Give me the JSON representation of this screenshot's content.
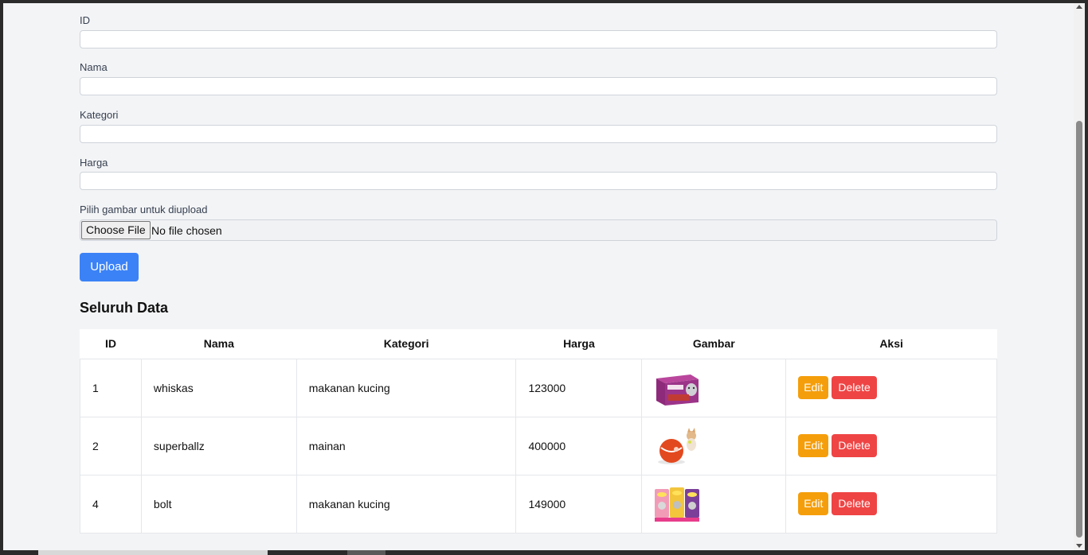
{
  "form": {
    "fields": [
      {
        "label": "ID",
        "value": ""
      },
      {
        "label": "Nama",
        "value": ""
      },
      {
        "label": "Kategori",
        "value": ""
      },
      {
        "label": "Harga",
        "value": ""
      }
    ],
    "file_label": "Pilih gambar untuk diupload",
    "file_button": "Choose File",
    "file_status": "No file chosen",
    "upload_label": "Upload"
  },
  "section_title": "Seluruh Data",
  "table": {
    "headers": [
      "ID",
      "Nama",
      "Kategori",
      "Harga",
      "Gambar",
      "Aksi"
    ],
    "rows": [
      {
        "id": "1",
        "nama": "whiskas",
        "kategori": "makanan kucing",
        "harga": "123000",
        "image": "whiskas-product-image"
      },
      {
        "id": "2",
        "nama": "superballz",
        "kategori": "mainan",
        "harga": "400000",
        "image": "superballz-product-image"
      },
      {
        "id": "4",
        "nama": "bolt",
        "kategori": "makanan kucing",
        "harga": "149000",
        "image": "bolt-product-image"
      }
    ],
    "edit_label": "Edit",
    "delete_label": "Delete"
  },
  "colors": {
    "upload": "#3b82f6",
    "edit": "#f59e0b",
    "delete": "#ef4444"
  }
}
